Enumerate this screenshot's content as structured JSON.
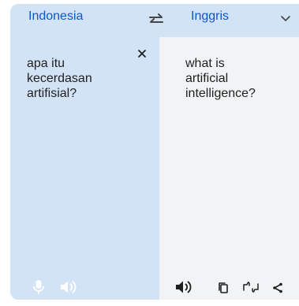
{
  "languages": {
    "source": "Indonesia",
    "target": "Inggris"
  },
  "source": {
    "text": "apa itu\nkecerdasan\nartifisial?"
  },
  "translation": {
    "text": "what is\nartificial\nintelligence?"
  },
  "icons": {
    "swap": "swap-languages-icon",
    "dropdown": "chevron-down-icon",
    "clear": "close-icon",
    "mic": "microphone-icon",
    "listen_source": "speaker-icon",
    "listen_target": "speaker-icon",
    "copy": "copy-icon",
    "feedback": "rate-translation-icon",
    "share": "share-icon"
  },
  "colors": {
    "accent": "#0b57d0",
    "source_bg": "#d3e3f6",
    "target_bg": "#f1f3f4",
    "text": "#1f1f1f",
    "icon_light": "#ffffff",
    "icon_dark": "#1f1f1f"
  }
}
